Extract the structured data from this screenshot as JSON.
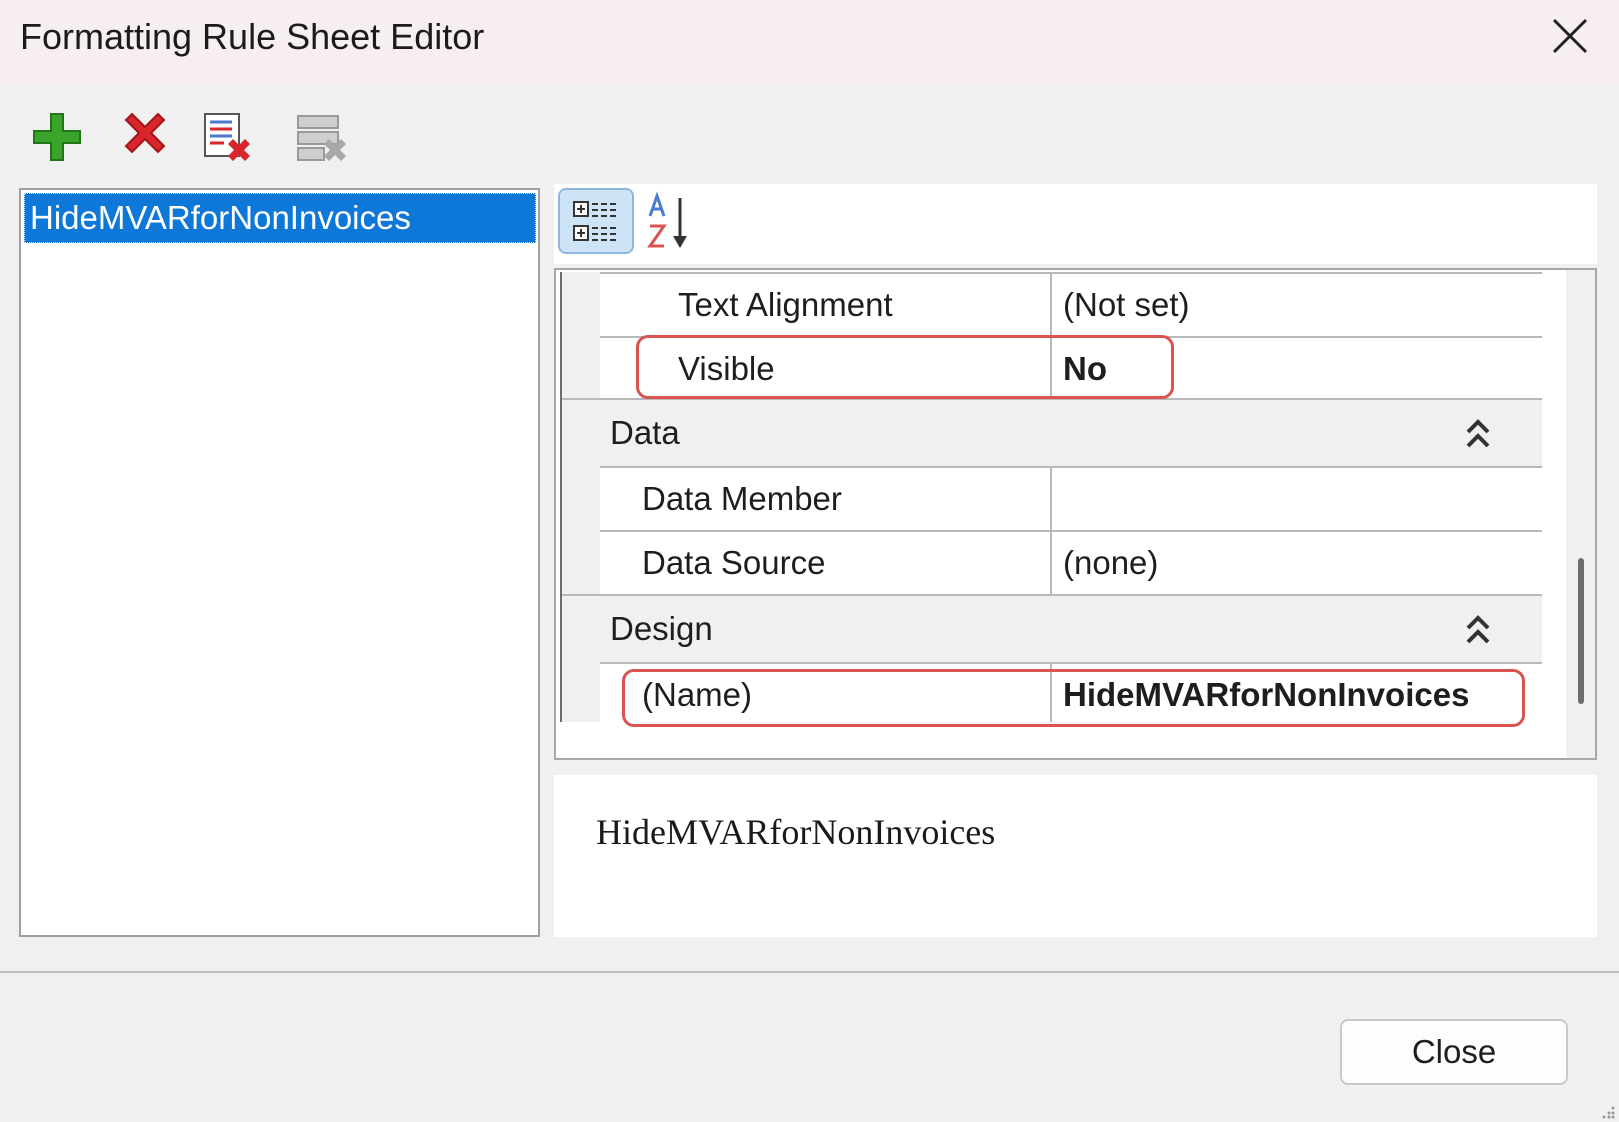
{
  "window": {
    "title": "Formatting Rule Sheet Editor"
  },
  "toolbar": {
    "buttons": [
      {
        "icon": "add-icon",
        "color": "#3aa52a"
      },
      {
        "icon": "delete-icon",
        "color": "#d9262c"
      },
      {
        "icon": "delete-sheet-icon"
      },
      {
        "icon": "clear-disabled-icon"
      }
    ]
  },
  "rules_list": {
    "items": [
      "HideMVARforNonInvoices"
    ],
    "selected": "HideMVARforNonInvoices"
  },
  "property_grid": {
    "view_buttons": [
      "categorized-icon",
      "alphabetical-sort-icon"
    ],
    "rows": {
      "text_alignment": {
        "name": "Text Alignment",
        "value": "(Not set)"
      },
      "visible": {
        "name": "Visible",
        "value": "No"
      },
      "data_member": {
        "name": "Data Member",
        "value": ""
      },
      "data_source": {
        "name": "Data Source",
        "value": "(none)"
      },
      "name": {
        "name": "(Name)",
        "value": "HideMVARforNonInvoices"
      }
    },
    "categories": {
      "data": "Data",
      "design": "Design"
    },
    "highlight_color": "#d9534f"
  },
  "description": {
    "text": "HideMVARforNonInvoices"
  },
  "footer": {
    "close_label": "Close"
  },
  "colors": {
    "selection": "#0d78d7",
    "title_bar": "#f7eef1"
  }
}
